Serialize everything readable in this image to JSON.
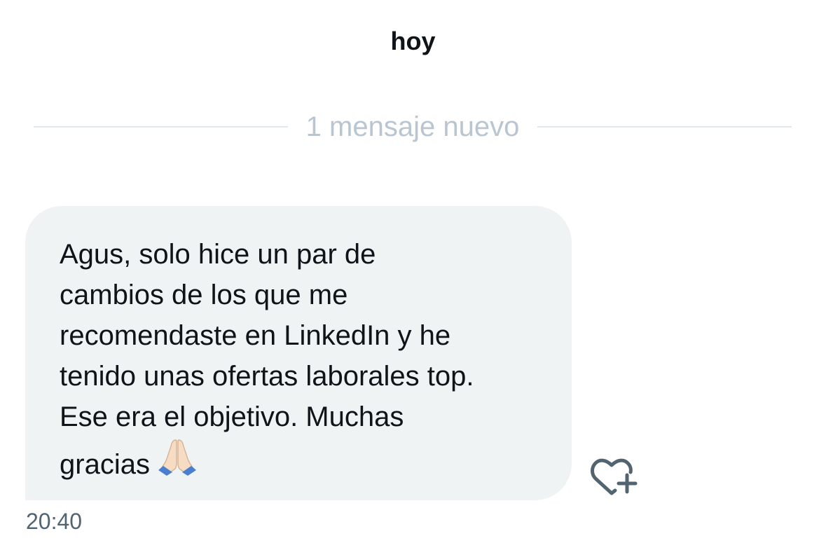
{
  "conversation": {
    "date_header": "hoy",
    "new_messages_divider": "1 mensaje nuevo",
    "message": {
      "text_line_1": "Agus, solo hice un par de",
      "text_line_2": "cambios de los que me",
      "text_line_3": "recomendaste en LinkedIn y he",
      "text_line_4": "tenido unas ofertas laborales top.",
      "text_line_5": "Ese era el objetivo. Muchas",
      "text_line_6": "gracias",
      "emoji": "folded-hands-emoji",
      "timestamp": "20:40"
    },
    "react_icon": "heart-plus-icon"
  },
  "colors": {
    "bubble_background": "#eff3f4",
    "text_primary": "#0f1419",
    "text_secondary": "#536471",
    "divider_text": "#b9c6d1",
    "divider_line": "#e1e8ed",
    "icon": "#536471"
  }
}
